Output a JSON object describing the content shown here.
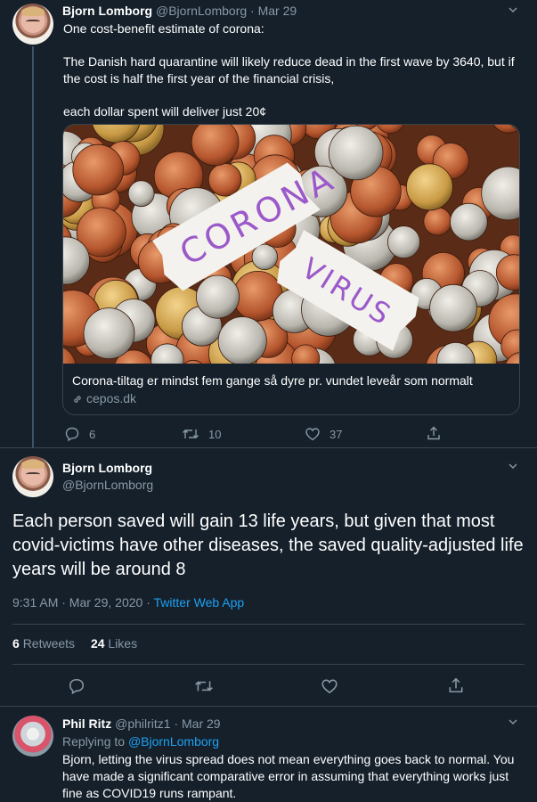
{
  "tweet1": {
    "name": "Bjorn Lomborg",
    "handle": "@BjornLomborg",
    "date": "· Mar 29",
    "lines": [
      "One cost-benefit estimate of corona:",
      "The Danish hard quarantine will likely reduce dead in the first wave by 3640, but if the cost is half the first year of the financial crisis,",
      "each dollar spent will deliver just 20¢"
    ],
    "card": {
      "image_text_1": "CORONA",
      "image_text_2": "VIRUS",
      "title": "Corona-tiltag er mindst fem gange så dyre pr. vundet leveår som normalt",
      "domain": "cepos.dk"
    },
    "actions": {
      "replies": "6",
      "retweets": "10",
      "likes": "37"
    }
  },
  "tweet2": {
    "name": "Bjorn Lomborg",
    "handle": "@BjornLomborg",
    "text": "Each person saved will gain 13 life years, but given that most covid-victims have other diseases, the saved quality-adjusted life years will be around 8",
    "time": "9:31 AM · Mar 29, 2020 · ",
    "source": "Twitter Web App",
    "retweets_count": "6",
    "retweets_label": "Retweets",
    "likes_count": "24",
    "likes_label": "Likes"
  },
  "reply": {
    "name": "Phil Ritz",
    "handle": "@philritz1",
    "date": "· Mar 29",
    "replying_prefix": "Replying to ",
    "replying_to": "@BjornLomborg",
    "text": "Bjorn, letting the virus spread does not mean everything goes back to normal.   You have made a significant comparative error in assuming that everything works just fine as COVID19 runs rampant."
  },
  "colors": {
    "background": "#15202b",
    "border": "#38444d",
    "muted": "#8899a6",
    "accent": "#1da1f2"
  }
}
